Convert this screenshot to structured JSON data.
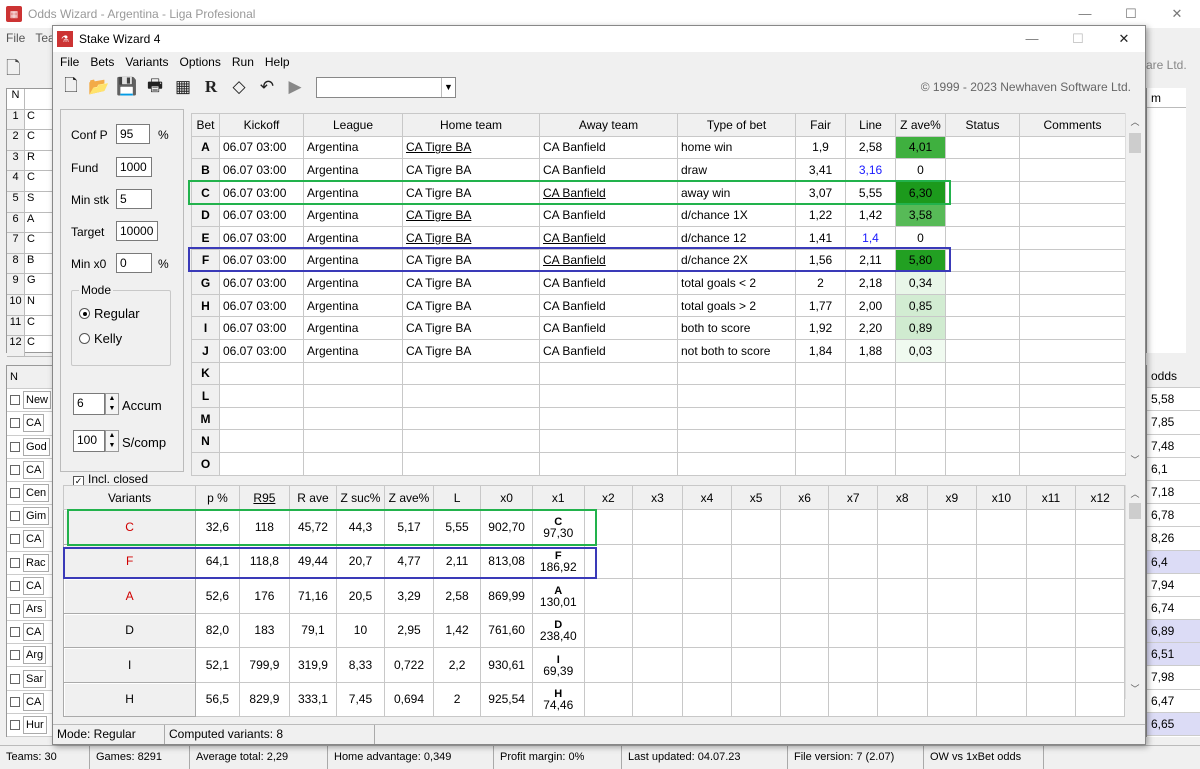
{
  "bg": {
    "title": "Odds Wizard - Argentina - Liga Profesional",
    "menu": [
      "File",
      "Tea"
    ],
    "corner_text": "are Ltd.",
    "table_header": "N",
    "row_numbers": [
      "1",
      "2",
      "3",
      "4",
      "5",
      "6",
      "7",
      "8",
      "9",
      "10",
      "11",
      "12"
    ],
    "row_letters": [
      "C",
      "C",
      "R",
      "C",
      "S",
      "A",
      "C",
      "B",
      "G",
      "N",
      "C",
      "C"
    ],
    "list_header": "N",
    "teams": [
      "New",
      "CA",
      "God",
      "CA",
      "Cen",
      "Gim",
      "CA",
      "Rac",
      "CA",
      "Ars",
      "CA",
      "Arg",
      "Sar",
      "CA",
      "Hur"
    ],
    "right_header": "m",
    "odds_header": "odds",
    "odds": [
      "5,58",
      "7,85",
      "7,48",
      "6,1",
      "7,18",
      "6,78",
      "8,26",
      "6,4",
      "7,94",
      "6,74",
      "6,89",
      "6,51",
      "7,98",
      "6,47",
      "6,65"
    ],
    "status": [
      "Teams: 30",
      "Games: 8291",
      "Average total: 2,29",
      "Home advantage: 0,349",
      "Profit margin: 0%",
      "Last updated: 04.07.23",
      "File version: 7 (2.07)",
      "OW vs 1xBet odds"
    ]
  },
  "sw": {
    "title": "Stake Wizard 4",
    "menu": [
      "File",
      "Bets",
      "Variants",
      "Options",
      "Run",
      "Help"
    ],
    "copyright": "© 1999 - 2023 Newhaven Software Ltd.",
    "params": {
      "confp_label": "Conf P",
      "confp": "95",
      "pct": "%",
      "fund_label": "Fund",
      "fund": "1000",
      "minstk_label": "Min stk",
      "minstk": "5",
      "target_label": "Target",
      "target": "10000",
      "minx0_label": "Min x0",
      "minx0": "0",
      "mode_label": "Mode",
      "regular": "Regular",
      "kelly": "Kelly",
      "accum": "6",
      "accum_label": "Accum",
      "scomp": "100",
      "scomp_label": "S/comp",
      "closed_label": "Incl. closed"
    },
    "bets_headers": [
      "Bet",
      "Kickoff",
      "League",
      "Home team",
      "Away team",
      "Type of bet",
      "Fair",
      "Line",
      "Z ave%",
      "Status",
      "Comments"
    ],
    "bets": [
      {
        "l": "A",
        "k": "06.07 03:00",
        "lg": "Argentina",
        "h": "CA Tigre BA",
        "a": "CA Banfield",
        "t": "home win",
        "f": "1,9",
        "li": "2,58",
        "z": "4,01",
        "hu": true,
        "au": false,
        "lb": false
      },
      {
        "l": "B",
        "k": "06.07 03:00",
        "lg": "Argentina",
        "h": "CA Tigre BA",
        "a": "CA Banfield",
        "t": "draw",
        "f": "3,41",
        "li": "3,16",
        "z": "0",
        "hu": false,
        "au": false,
        "lb": true
      },
      {
        "l": "C",
        "k": "06.07 03:00",
        "lg": "Argentina",
        "h": "CA Tigre BA",
        "a": "CA Banfield",
        "t": "away win",
        "f": "3,07",
        "li": "5,55",
        "z": "6,30",
        "hu": false,
        "au": true,
        "lb": false
      },
      {
        "l": "D",
        "k": "06.07 03:00",
        "lg": "Argentina",
        "h": "CA Tigre BA",
        "a": "CA Banfield",
        "t": "d/chance 1X",
        "f": "1,22",
        "li": "1,42",
        "z": "3,58",
        "hu": true,
        "au": false,
        "lb": false
      },
      {
        "l": "E",
        "k": "06.07 03:00",
        "lg": "Argentina",
        "h": "CA Tigre BA",
        "a": "CA Banfield",
        "t": "d/chance 12",
        "f": "1,41",
        "li": "1,4",
        "z": "0",
        "hu": true,
        "au": true,
        "lb": true
      },
      {
        "l": "F",
        "k": "06.07 03:00",
        "lg": "Argentina",
        "h": "CA Tigre BA",
        "a": "CA Banfield",
        "t": "d/chance 2X",
        "f": "1,56",
        "li": "2,11",
        "z": "5,80",
        "hu": false,
        "au": true,
        "lb": false
      },
      {
        "l": "G",
        "k": "06.07 03:00",
        "lg": "Argentina",
        "h": "CA Tigre BA",
        "a": "CA Banfield",
        "t": "total goals < 2",
        "f": "2",
        "li": "2,18",
        "z": "0,34",
        "hu": false,
        "au": false,
        "lb": false
      },
      {
        "l": "H",
        "k": "06.07 03:00",
        "lg": "Argentina",
        "h": "CA Tigre BA",
        "a": "CA Banfield",
        "t": "total goals > 2",
        "f": "1,77",
        "li": "2,00",
        "z": "0,85",
        "hu": false,
        "au": false,
        "lb": false
      },
      {
        "l": "I",
        "k": "06.07 03:00",
        "lg": "Argentina",
        "h": "CA Tigre BA",
        "a": "CA Banfield",
        "t": "both to score",
        "f": "1,92",
        "li": "2,20",
        "z": "0,89",
        "hu": false,
        "au": false,
        "lb": false
      },
      {
        "l": "J",
        "k": "06.07 03:00",
        "lg": "Argentina",
        "h": "CA Tigre BA",
        "a": "CA Banfield",
        "t": "not both to score",
        "f": "1,84",
        "li": "1,88",
        "z": "0,03",
        "hu": false,
        "au": false,
        "lb": false
      },
      {
        "l": "K"
      },
      {
        "l": "L"
      },
      {
        "l": "M"
      },
      {
        "l": "N"
      },
      {
        "l": "O"
      }
    ],
    "z_colors": {
      "4,01": "#3fb03f",
      "0": "#ffffff",
      "6,30": "#1c9a1c",
      "3,58": "#57ba57",
      "5,80": "#22a022",
      "0,34": "#e8f6e8",
      "0,85": "#d2ecd2",
      "0,89": "#d0ebd0",
      "0,03": "#f0faf0"
    },
    "var_headers": [
      "Variants",
      "p %",
      "R95",
      "R ave",
      "Z suc%",
      "Z ave%",
      "L",
      "x0",
      "x1",
      "x2",
      "x3",
      "x4",
      "x5",
      "x6",
      "x7",
      "x8",
      "x9",
      "x10",
      "x11",
      "x12"
    ],
    "variants": [
      {
        "n": "C",
        "red": true,
        "p": "32,6",
        "r95": "118",
        "rave": "45,72",
        "zs": "44,3",
        "za": "5,17",
        "l": "5,55",
        "x0": "902,70",
        "x1l": "C",
        "x1v": "97,30"
      },
      {
        "n": "F",
        "red": true,
        "p": "64,1",
        "r95": "118,8",
        "rave": "49,44",
        "zs": "20,7",
        "za": "4,77",
        "l": "2,11",
        "x0": "813,08",
        "x1l": "F",
        "x1v": "186,92"
      },
      {
        "n": "A",
        "red": true,
        "p": "52,6",
        "r95": "176",
        "rave": "71,16",
        "zs": "20,5",
        "za": "3,29",
        "l": "2,58",
        "x0": "869,99",
        "x1l": "A",
        "x1v": "130,01"
      },
      {
        "n": "D",
        "red": false,
        "p": "82,0",
        "r95": "183",
        "rave": "79,1",
        "zs": "10",
        "za": "2,95",
        "l": "1,42",
        "x0": "761,60",
        "x1l": "D",
        "x1v": "238,40"
      },
      {
        "n": "I",
        "red": false,
        "p": "52,1",
        "r95": "799,9",
        "rave": "319,9",
        "zs": "8,33",
        "za": "0,722",
        "l": "2,2",
        "x0": "930,61",
        "x1l": "I",
        "x1v": "69,39"
      },
      {
        "n": "H",
        "red": false,
        "p": "56,5",
        "r95": "829,9",
        "rave": "333,1",
        "zs": "7,45",
        "za": "0,694",
        "l": "2",
        "x0": "925,54",
        "x1l": "H",
        "x1v": "74,46"
      }
    ],
    "status": [
      "Mode: Regular",
      "Computed variants: 8"
    ]
  }
}
